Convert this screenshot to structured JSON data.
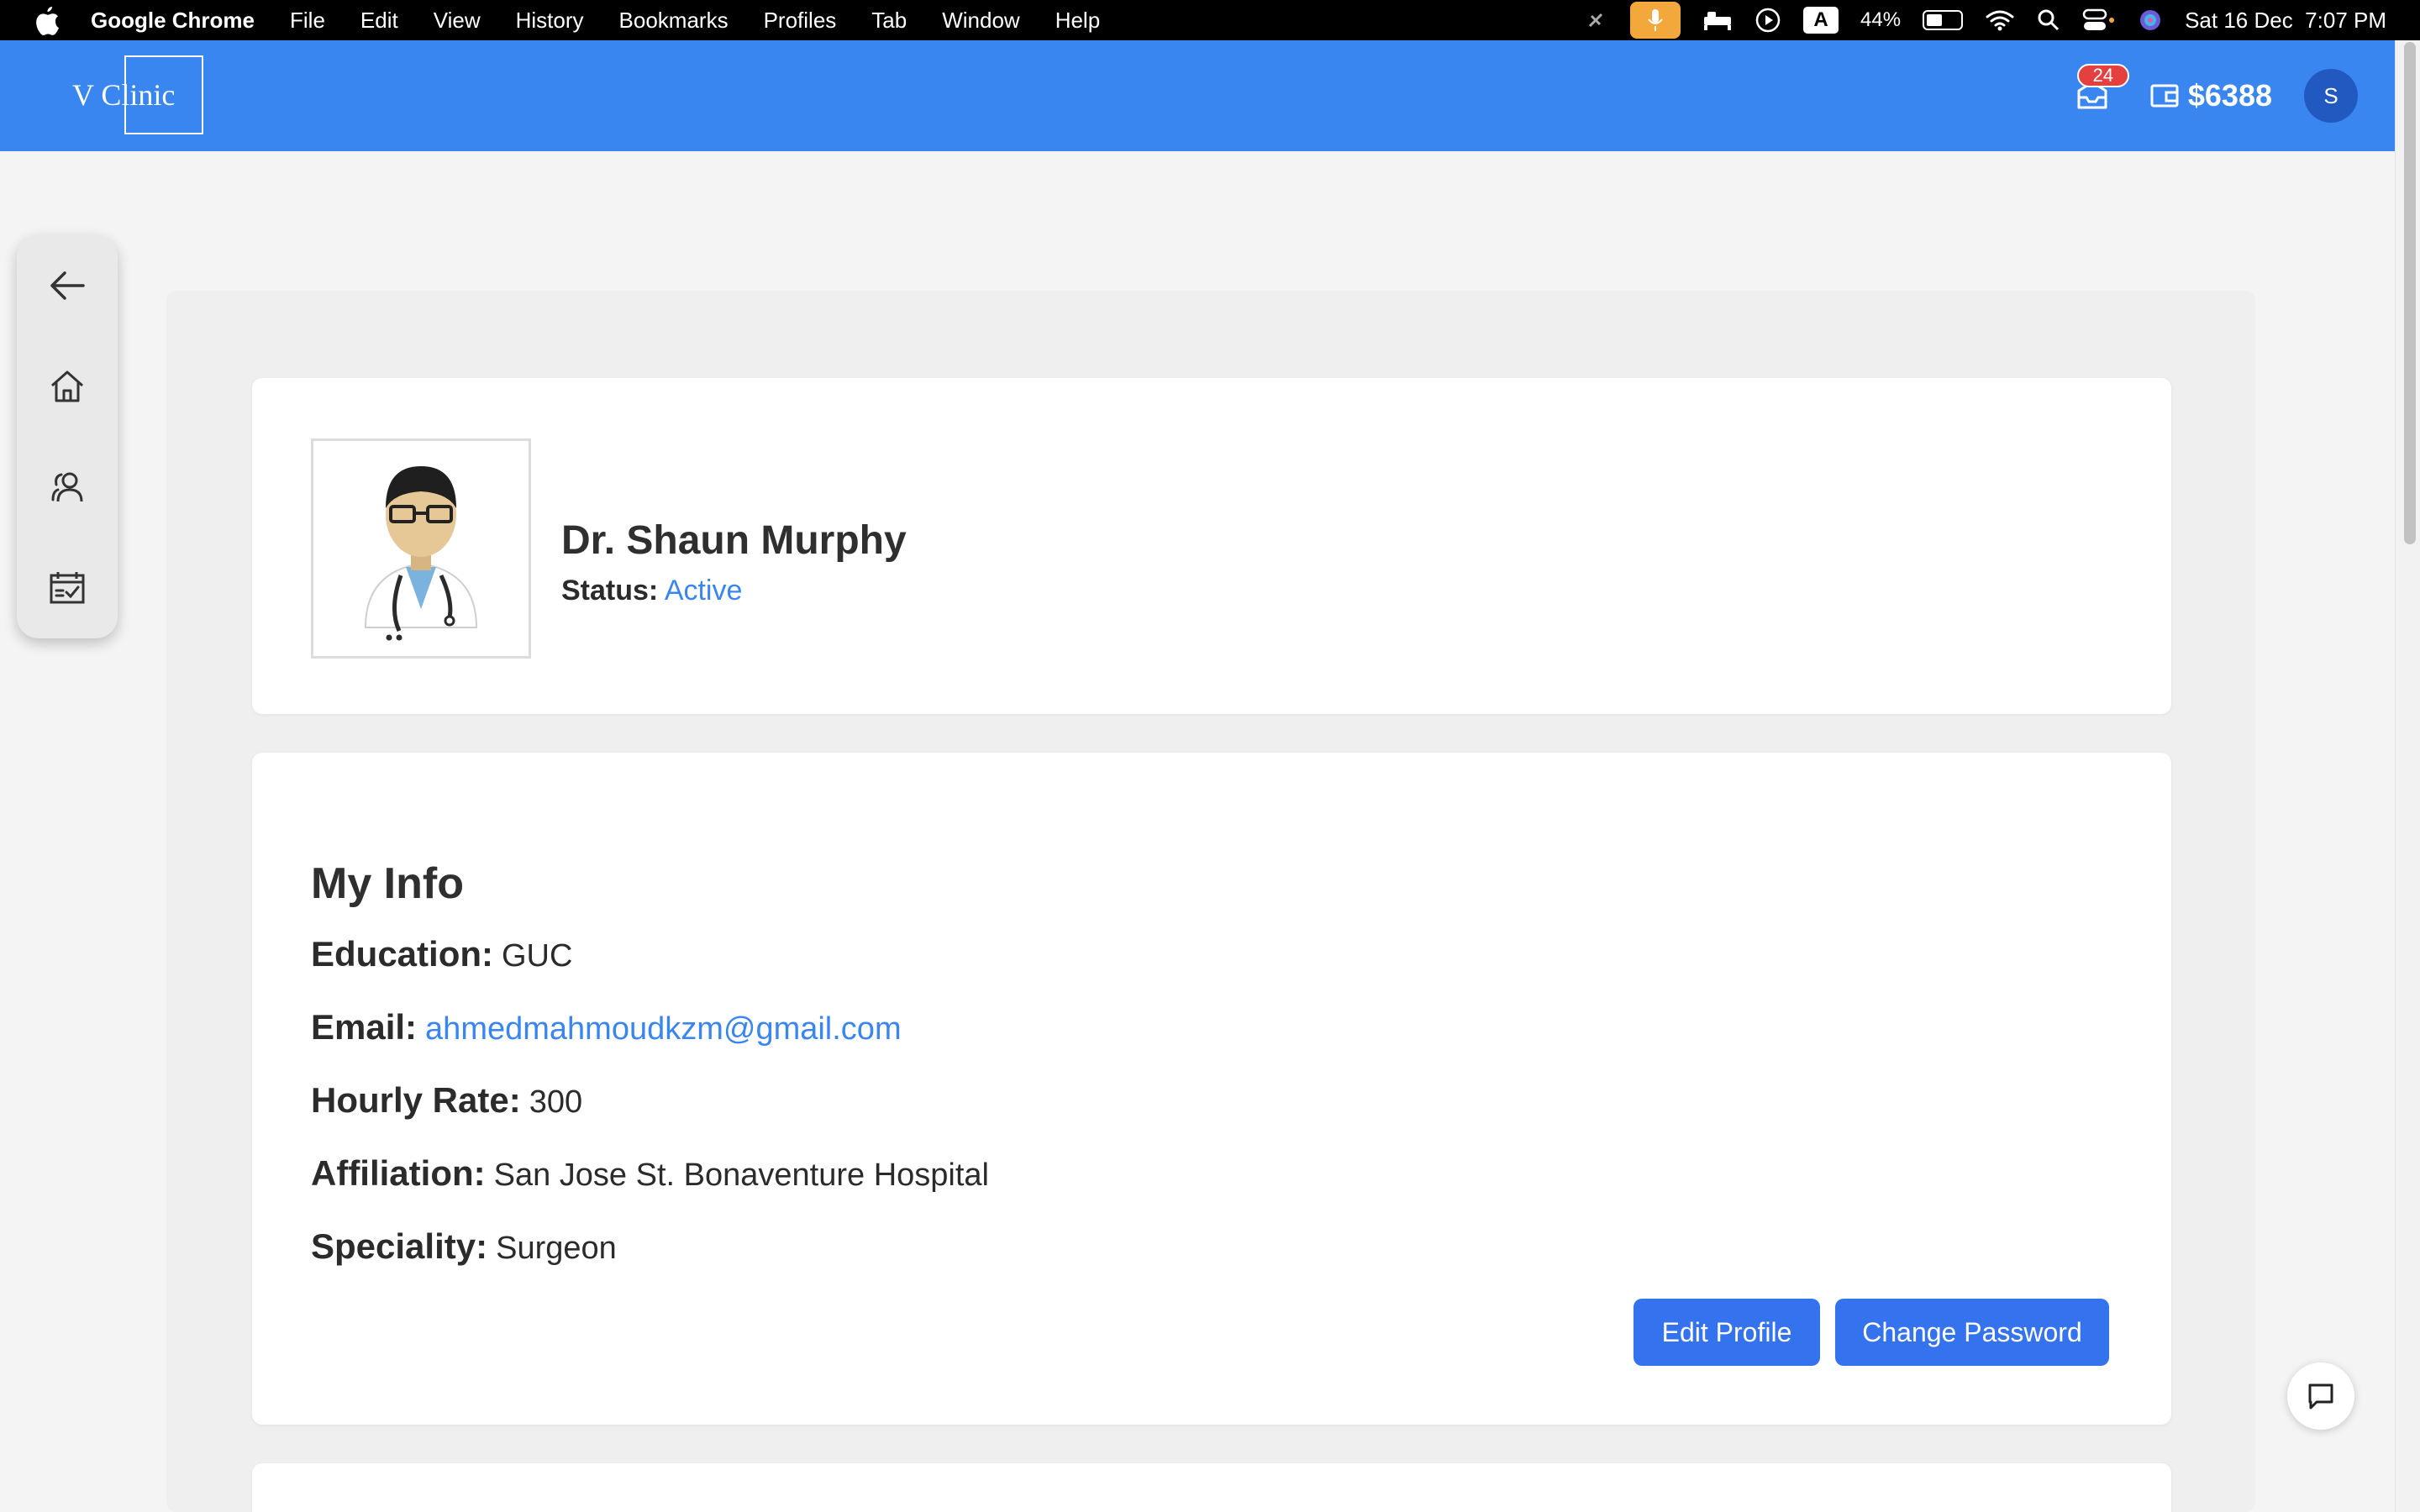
{
  "menubar": {
    "app_name": "Google Chrome",
    "menus": [
      "File",
      "Edit",
      "View",
      "History",
      "Bookmarks",
      "Profiles",
      "Tab",
      "Window",
      "Help"
    ],
    "input_indicator": "A",
    "battery": "44%",
    "datetime": "Sat 16 Dec  7:07 PM"
  },
  "header": {
    "logo": "V Clinic",
    "notifications_count": "24",
    "wallet_balance": "$6388",
    "avatar_initial": "S",
    "accent_color": "#3a86f1"
  },
  "sidenav": {
    "items": [
      "arrow-left-icon",
      "home-icon",
      "users-icon",
      "calendar-check-icon"
    ]
  },
  "profile": {
    "name": "Dr. Shaun Murphy",
    "status_label": "Status:",
    "status_value": "Active"
  },
  "info": {
    "title": "My Info",
    "education_label": "Education:",
    "education": "GUC",
    "email_label": "Email:",
    "email": "ahmedmahmoudkzm@gmail.com",
    "rate_label": "Hourly Rate:",
    "rate": "300",
    "affiliation_label": "Affiliation:",
    "affiliation": "San Jose St. Bonaventure Hospital",
    "speciality_label": "Speciality:",
    "speciality": "Surgeon"
  },
  "actions": {
    "edit_label": "Edit Profile",
    "password_label": "Change Password"
  }
}
